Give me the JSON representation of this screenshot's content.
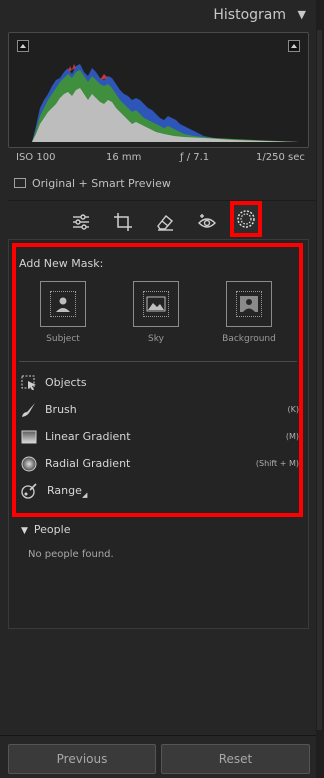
{
  "header": {
    "title": "Histogram",
    "collapse_icon": "triangle-down-icon"
  },
  "histogram": {
    "exif": {
      "iso": "ISO 100",
      "focal": "16 mm",
      "aperture": "ƒ / 7.1",
      "shutter": "1/250 sec"
    },
    "preview_label": "Original + Smart Preview",
    "colors": {
      "red": "#c23a3a",
      "green": "#3f8f3f",
      "blue": "#2d56b8",
      "gray": "#bdbdbd"
    }
  },
  "toolbar": {
    "tools": [
      "edit-sliders-icon",
      "crop-icon",
      "healing-eraser-icon",
      "red-eye-icon",
      "masking-icon"
    ],
    "active": "masking-icon"
  },
  "masking": {
    "add_new_label": "Add New Mask:",
    "tiles": [
      {
        "label": "Subject",
        "icon": "subject-person-icon"
      },
      {
        "label": "Sky",
        "icon": "sky-landscape-icon"
      },
      {
        "label": "Background",
        "icon": "background-person-icon"
      }
    ],
    "rows": [
      {
        "label": "Objects",
        "shortcut": "",
        "icon": "objects-select-icon"
      },
      {
        "label": "Brush",
        "shortcut": "(K)",
        "icon": "brush-icon"
      },
      {
        "label": "Linear Gradient",
        "shortcut": "(M)",
        "icon": "linear-gradient-icon"
      },
      {
        "label": "Radial Gradient",
        "shortcut": "(Shift + M)",
        "icon": "radial-gradient-icon"
      },
      {
        "label": "Range",
        "shortcut": "",
        "icon": "range-icon"
      }
    ]
  },
  "people": {
    "header": "People",
    "empty_text": "No people found."
  },
  "footer": {
    "previous_label": "Previous",
    "reset_label": "Reset"
  },
  "accent": {
    "highlight": "#ff0000"
  }
}
